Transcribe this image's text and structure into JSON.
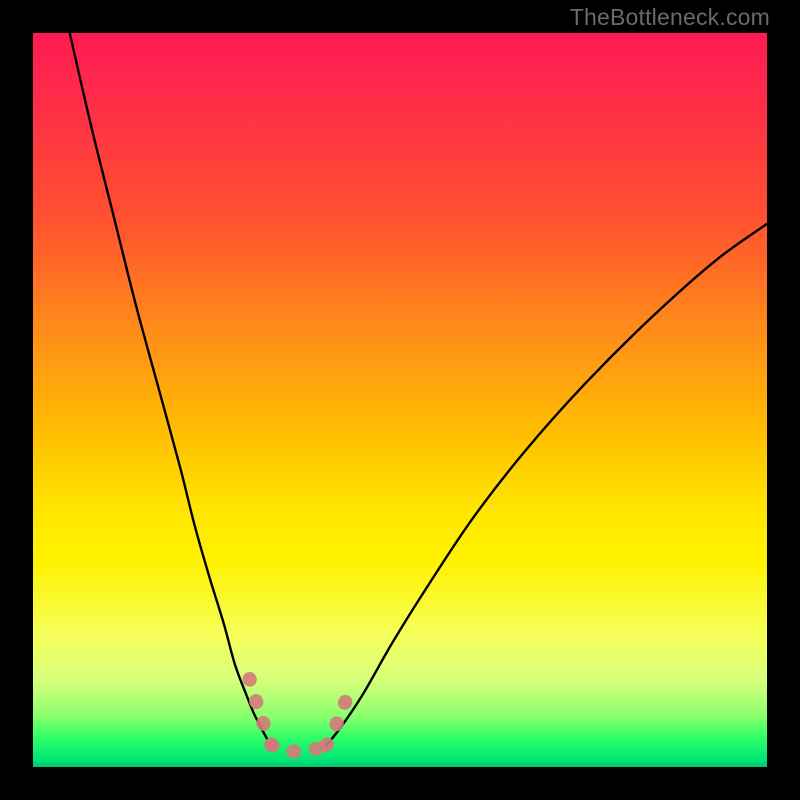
{
  "watermark": "TheBottleneck.com",
  "chart_data": {
    "type": "line",
    "title": "",
    "xlabel": "",
    "ylabel": "",
    "xlim": [
      0,
      100
    ],
    "ylim": [
      0,
      100
    ],
    "grid": false,
    "legend": false,
    "series": [
      {
        "name": "left-curve",
        "stroke": "#000000",
        "x": [
          5,
          8,
          11,
          14,
          17,
          20,
          22,
          24,
          26,
          27.5,
          29,
          30,
          31,
          31.8,
          32.5
        ],
        "y": [
          100,
          87,
          75,
          63,
          52,
          41,
          33,
          26,
          19.5,
          14,
          10,
          7.5,
          5.5,
          4,
          3
        ]
      },
      {
        "name": "right-curve",
        "stroke": "#000000",
        "x": [
          40,
          42,
          45,
          49,
          54,
          60,
          67,
          75,
          84,
          93,
          100
        ],
        "y": [
          3,
          5.5,
          10,
          17,
          25,
          34,
          43,
          52,
          61,
          69,
          74
        ]
      },
      {
        "name": "valley-highlight-floor",
        "stroke": "#d47a7a",
        "x": [
          32.5,
          34,
          36,
          38,
          40
        ],
        "y": [
          3,
          2.3,
          2.1,
          2.3,
          3
        ]
      },
      {
        "name": "valley-highlight-left-wall",
        "stroke": "#d47a7a",
        "x": [
          29.5,
          31,
          32,
          32.5
        ],
        "y": [
          12,
          7,
          4.5,
          3
        ]
      },
      {
        "name": "valley-highlight-right-wall",
        "stroke": "#d47a7a",
        "x": [
          40,
          41,
          42,
          43
        ],
        "y": [
          3,
          5,
          7.5,
          10
        ]
      }
    ],
    "background_gradient": {
      "top": "#ff1a52",
      "mid": "#ffe600",
      "bottom": "#00e676"
    }
  }
}
